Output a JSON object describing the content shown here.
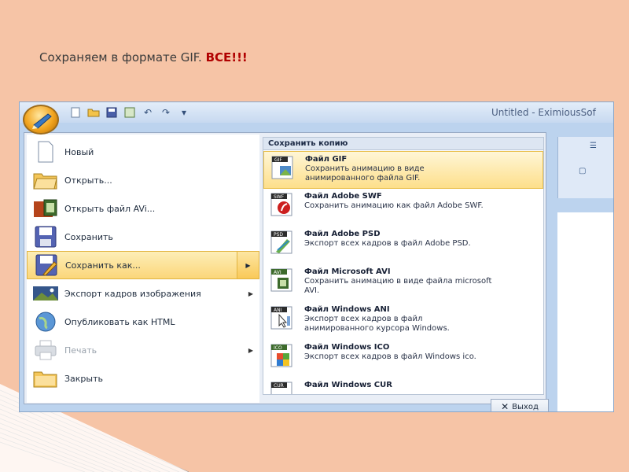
{
  "slide": {
    "title_main": "Сохраняем в формате GIF. ",
    "title_highlight": "ВСЕ!!!"
  },
  "window": {
    "app_title": "Untitled - EximiousSof"
  },
  "quick_access": [
    "new-doc-icon",
    "open-folder-icon",
    "save-icon",
    "film-icon",
    "undo-icon",
    "redo-icon",
    "dropdown-icon"
  ],
  "menu": {
    "left_items": [
      {
        "label": "Новый",
        "icon": "new-document-icon"
      },
      {
        "label": "Открыть...",
        "icon": "open-folder-icon"
      },
      {
        "label": "Открыть файл AVi...",
        "icon": "film-icon"
      },
      {
        "label": "Сохранить",
        "icon": "save-icon"
      },
      {
        "label": "Сохранить как...",
        "icon": "save-as-icon"
      },
      {
        "label": "Экспорт кадров изображения",
        "icon": "image-export-icon"
      },
      {
        "label": "Опубликовать как HTML",
        "icon": "globe-icon"
      },
      {
        "label": "Печать",
        "icon": "printer-icon"
      },
      {
        "label": "Закрыть",
        "icon": "close-folder-icon"
      }
    ],
    "submenu_title": "Сохранить копию",
    "right_items": [
      {
        "title": "Файл GIF",
        "desc1": "Сохранить анимацию в виде",
        "desc2": "анимированного файла GIF.",
        "badge": "GIF"
      },
      {
        "title": "Файл Adobe SWF",
        "desc1": "Сохранить анимацию как файл Adobe SWF.",
        "desc2": "",
        "badge": "SWF"
      },
      {
        "title": "Файл Adobe PSD",
        "desc1": "Экспорт всех кадров в файл Adobe PSD.",
        "desc2": "",
        "badge": "PSD"
      },
      {
        "title": "Файл Microsoft AVI",
        "desc1": "Сохранить анимацию в виде файла microsoft",
        "desc2": "AVI.",
        "badge": "AVI"
      },
      {
        "title": "Файл Windows ANI",
        "desc1": "Экспорт всех кадров в файл",
        "desc2": "анимированного курсора Windows.",
        "badge": "ANI"
      },
      {
        "title": "Файл Windows ICO",
        "desc1": "Экспорт всех кадров в файл Windows ico.",
        "desc2": "",
        "badge": "ICO"
      },
      {
        "title": "Файл Windows CUR",
        "desc1": "",
        "desc2": "",
        "badge": "CUR"
      }
    ],
    "exit_label": "Выход"
  },
  "colors": {
    "slide_bg": "#f6c4a6",
    "highlight_red": "#b00000",
    "menu_active": "#fbd67a"
  }
}
